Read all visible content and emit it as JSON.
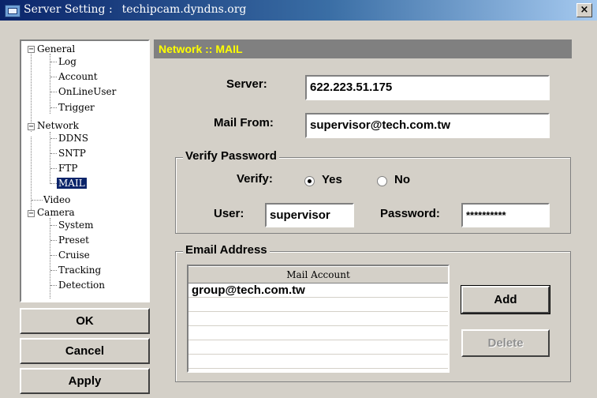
{
  "window": {
    "title_label": "Server Setting :",
    "host": "techipcam.dyndns.org",
    "close_glyph": "×"
  },
  "tree": {
    "general": "General",
    "log": "Log",
    "account": "Account",
    "online_user": "OnLineUser",
    "trigger": "Trigger",
    "network": "Network",
    "ddns": "DDNS",
    "sntp": "SNTP",
    "ftp": "FTP",
    "mail": "MAIL",
    "video": "Video",
    "camera": "Camera",
    "system": "System",
    "preset": "Preset",
    "cruise": "Cruise",
    "tracking": "Tracking",
    "detection": "Detection",
    "collapse_glyph": "−"
  },
  "buttons": {
    "ok": "OK",
    "cancel": "Cancel",
    "apply": "Apply",
    "add": "Add",
    "delete": "Delete"
  },
  "header": {
    "title": "Network :: MAIL"
  },
  "form": {
    "server_label": "Server:",
    "server_value": "622.223.51.175",
    "mail_from_label": "Mail From:",
    "mail_from_value": "supervisor@tech.com.tw"
  },
  "verify": {
    "group_label": "Verify Password",
    "verify_label": "Verify:",
    "yes_label": "Yes",
    "no_label": "No",
    "selected": "Yes",
    "user_label": "User:",
    "user_value": "supervisor",
    "password_label": "Password:",
    "password_value": "**********"
  },
  "email": {
    "group_label": "Email Address",
    "column_header": "Mail Account",
    "rows": [
      "group@tech.com.tw"
    ]
  }
}
